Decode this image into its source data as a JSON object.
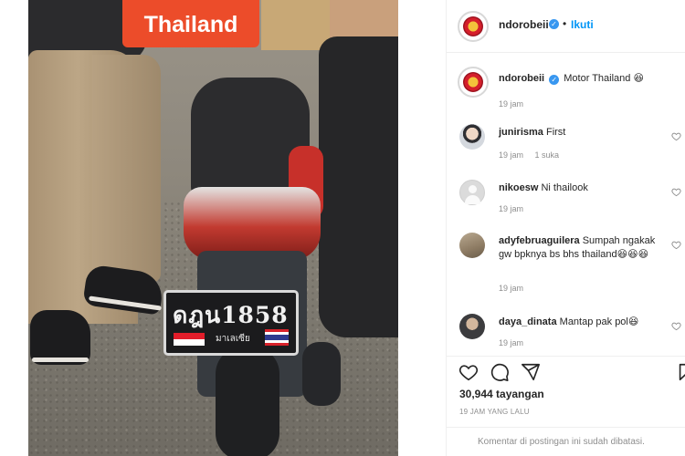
{
  "video": {
    "caption_label": "Thailand",
    "plate_main": "ดฎน1858",
    "plate_sub": "มาเลเซีย"
  },
  "post": {
    "header": {
      "username": "ndorobeii",
      "separator": "•",
      "follow_label": "Ikuti"
    },
    "caption": {
      "username": "ndorobeii",
      "text": "Motor Thailand 😆",
      "time": "19 jam"
    },
    "comments": [
      {
        "username": "junirisma",
        "text": "First",
        "time": "19 jam",
        "likes": "1 suka"
      },
      {
        "username": "nikoesw",
        "text": "Ni thailook",
        "time": "19 jam",
        "likes": ""
      },
      {
        "username": "adyfebruaguilera",
        "text": "Sumpah ngakak gw bpknya bs bhs thailand😆😆😆",
        "time": "19 jam",
        "likes": ""
      },
      {
        "username": "daya_dinata",
        "text": "Mantap pak pol😆",
        "time": "19 jam",
        "likes": ""
      }
    ],
    "views": "30,944 tayangan",
    "posted_ago": "19 JAM YANG LALU",
    "comments_limited": "Komentar di postingan ini sudah dibatasi."
  },
  "colors": {
    "accent": "#0095f6",
    "verified": "#3897f0",
    "caption_bg": "#ec4c2a",
    "muted_text": "#8e8e8e"
  },
  "icons": [
    "verified-badge-icon",
    "heart-icon",
    "comment-icon",
    "share-icon",
    "bookmark-icon"
  ]
}
